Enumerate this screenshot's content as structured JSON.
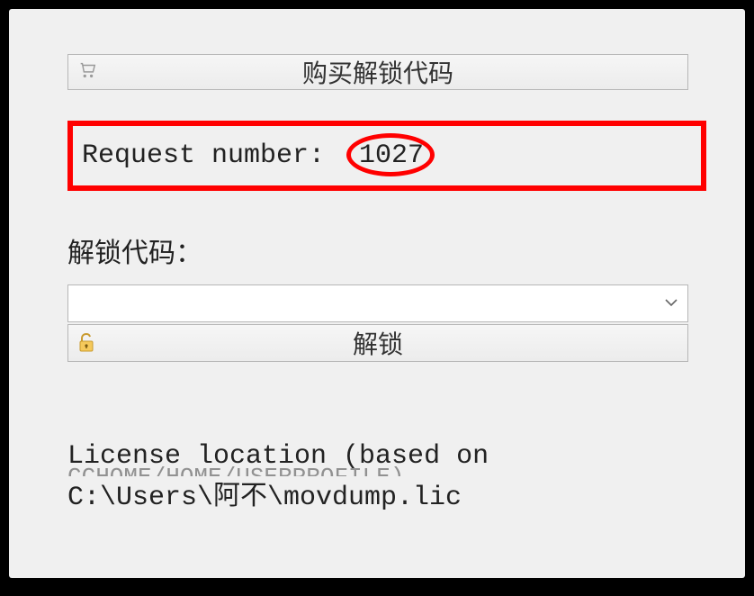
{
  "buy": {
    "label": "购买解锁代码"
  },
  "request": {
    "label": "Request number:",
    "value": "1027"
  },
  "unlock": {
    "section_label": "解锁代码：",
    "dropdown_value": "",
    "button_label": "解锁"
  },
  "license": {
    "line1": "License location (based on",
    "truncated": "CCHOME/HOME/USERPROFILE)",
    "path": "C:\\Users\\阿不\\movdump.lic"
  }
}
